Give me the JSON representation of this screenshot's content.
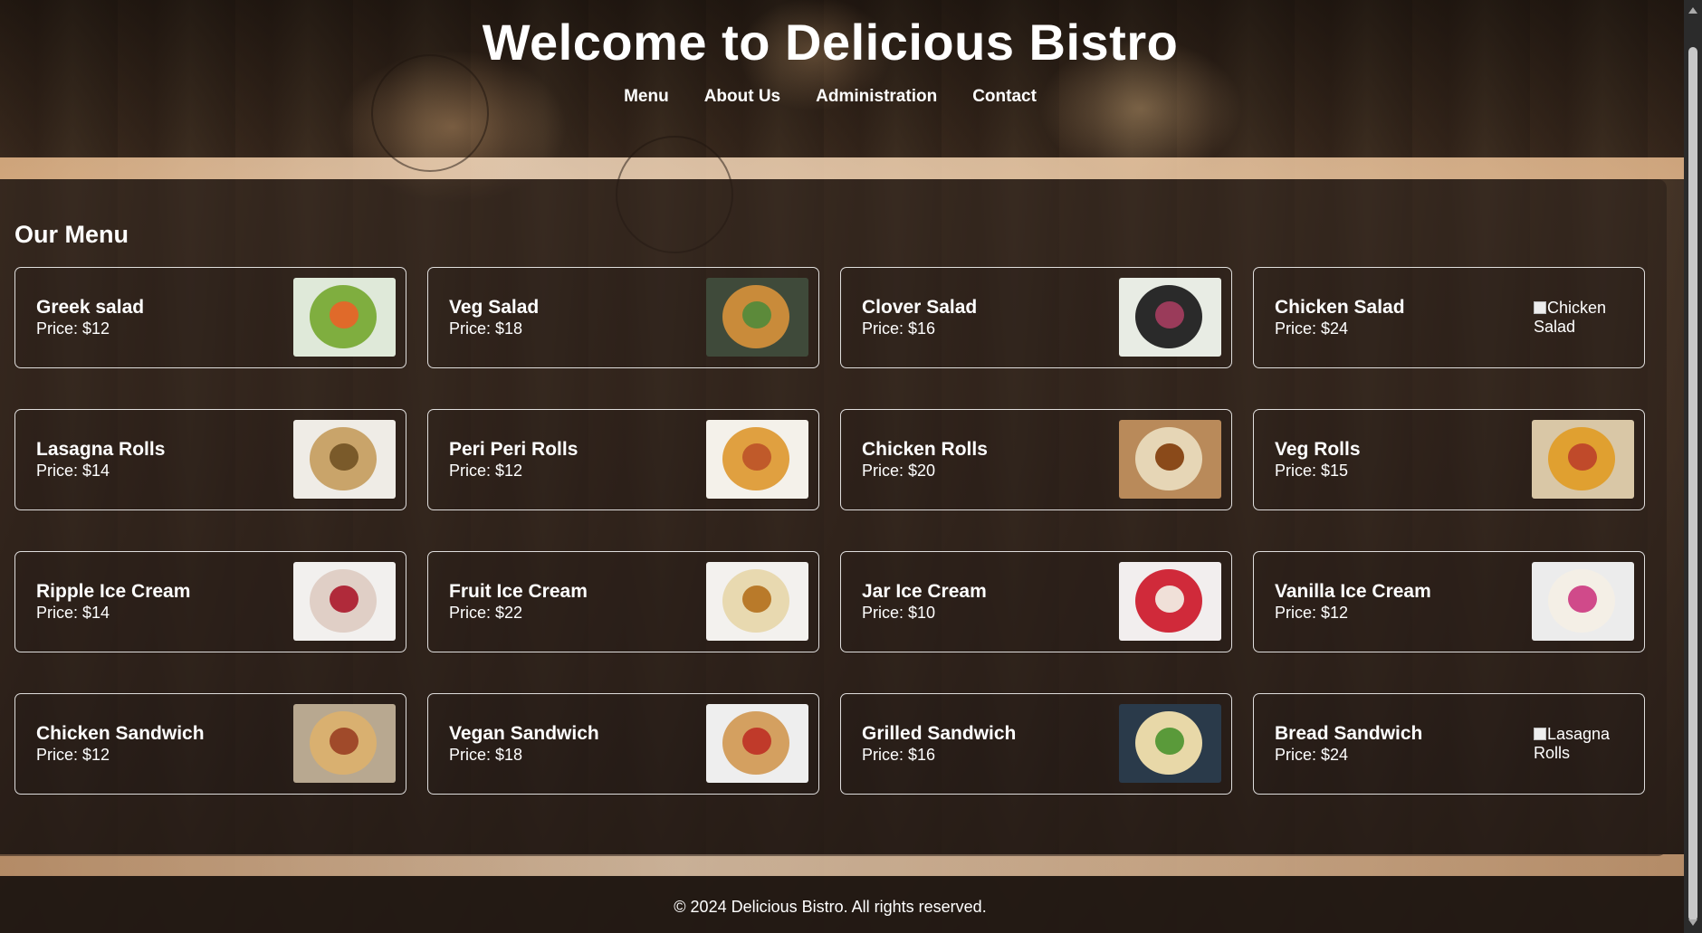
{
  "header": {
    "title": "Welcome to Delicious Bistro",
    "nav": [
      "Menu",
      "About Us",
      "Administration",
      "Contact"
    ]
  },
  "menu": {
    "title": "Our Menu",
    "items": [
      {
        "name": "Greek salad",
        "price": "Price: $12",
        "image": "greek-salad-image",
        "colors": [
          "#dfe9d9",
          "#7fae3f",
          "#e06a2a"
        ]
      },
      {
        "name": "Veg Salad",
        "price": "Price: $18",
        "image": "veg-salad-image",
        "colors": [
          "#3f4a3a",
          "#c98b3a",
          "#5c8a3a"
        ]
      },
      {
        "name": "Clover Salad",
        "price": "Price: $16",
        "image": "clover-salad-image",
        "colors": [
          "#e8ece4",
          "#2a2a2a",
          "#9a3b5a"
        ]
      },
      {
        "name": "Chicken Salad",
        "price": "Price: $24",
        "image_alt": "Chicken Salad"
      },
      {
        "name": "Lasagna Rolls",
        "price": "Price: $14",
        "image": "lasagna-rolls-image",
        "colors": [
          "#efece6",
          "#c9a46a",
          "#7a5a2a"
        ]
      },
      {
        "name": "Peri Peri Rolls",
        "price": "Price: $12",
        "image": "peri-peri-rolls-image",
        "colors": [
          "#f4f1ea",
          "#e0a040",
          "#c05a2a"
        ]
      },
      {
        "name": "Chicken Rolls",
        "price": "Price: $20",
        "image": "chicken-rolls-image",
        "colors": [
          "#b98a5a",
          "#e6d6b6",
          "#8a4a1a"
        ]
      },
      {
        "name": "Veg Rolls",
        "price": "Price: $15",
        "image": "veg-rolls-image",
        "colors": [
          "#d9c7a6",
          "#e0a030",
          "#c04a2a"
        ]
      },
      {
        "name": "Ripple Ice Cream",
        "price": "Price: $14",
        "image": "ripple-ice-cream-image",
        "colors": [
          "#f2f0ee",
          "#e0cfc6",
          "#b02a3a"
        ]
      },
      {
        "name": "Fruit Ice Cream",
        "price": "Price: $22",
        "image": "fruit-ice-cream-image",
        "colors": [
          "#f3f1ee",
          "#e8d9b0",
          "#b97a2a"
        ]
      },
      {
        "name": "Jar Ice Cream",
        "price": "Price: $10",
        "image": "jar-ice-cream-image",
        "colors": [
          "#f2eeee",
          "#d02a3a",
          "#f0e0d8"
        ]
      },
      {
        "name": "Vanilla Ice Cream",
        "price": "Price: $12",
        "image": "vanilla-ice-cream-image",
        "colors": [
          "#ececec",
          "#f4efe6",
          "#d04a8a"
        ]
      },
      {
        "name": "Chicken Sandwich",
        "price": "Price: $12",
        "image": "chicken-sandwich-image",
        "colors": [
          "#b8a890",
          "#d9b070",
          "#a04a2a"
        ]
      },
      {
        "name": "Vegan Sandwich",
        "price": "Price: $18",
        "image": "vegan-sandwich-image",
        "colors": [
          "#eeeeee",
          "#d4a060",
          "#c03a2a"
        ]
      },
      {
        "name": "Grilled Sandwich",
        "price": "Price: $16",
        "image": "grilled-sandwich-image",
        "colors": [
          "#2a3a4a",
          "#e8d8a8",
          "#5a9a3a"
        ]
      },
      {
        "name": "Bread Sandwich",
        "price": "Price: $24",
        "image_alt": "Lasagna Rolls"
      }
    ]
  },
  "footer": {
    "text": "© 2024 Delicious Bistro. All rights reserved."
  }
}
